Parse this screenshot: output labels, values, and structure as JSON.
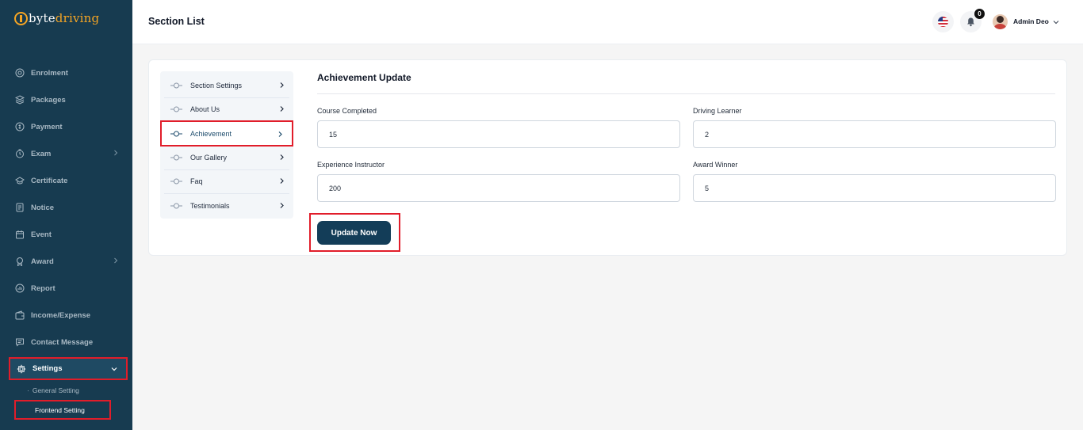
{
  "brand": {
    "part1": "byte",
    "part2": "driving"
  },
  "sidebar": {
    "items": [
      {
        "label": "Enrolment",
        "icon": "enrolment-icon",
        "chevron": false,
        "active": false
      },
      {
        "label": "Packages",
        "icon": "packages-icon",
        "chevron": false,
        "active": false
      },
      {
        "label": "Payment",
        "icon": "payment-icon",
        "chevron": false,
        "active": false
      },
      {
        "label": "Exam",
        "icon": "exam-icon",
        "chevron": true,
        "active": false
      },
      {
        "label": "Certificate",
        "icon": "certificate-icon",
        "chevron": false,
        "active": false
      },
      {
        "label": "Notice",
        "icon": "notice-icon",
        "chevron": false,
        "active": false
      },
      {
        "label": "Event",
        "icon": "event-icon",
        "chevron": false,
        "active": false
      },
      {
        "label": "Award",
        "icon": "award-icon",
        "chevron": true,
        "active": false
      },
      {
        "label": "Report",
        "icon": "report-icon",
        "chevron": false,
        "active": false
      },
      {
        "label": "Income/Expense",
        "icon": "wallet-icon",
        "chevron": false,
        "active": false
      },
      {
        "label": "Contact Message",
        "icon": "message-icon",
        "chevron": false,
        "active": false
      },
      {
        "label": "Settings",
        "icon": "gear-icon",
        "chevron": true,
        "active": true
      }
    ],
    "sub_items": [
      {
        "label": "General Setting",
        "active": false
      },
      {
        "label": "Frontend Setting",
        "active": true
      }
    ]
  },
  "header": {
    "title": "Section List",
    "notification_count": "0",
    "user_name": "Admin Deo"
  },
  "sections": {
    "items": [
      {
        "label": "Section Settings",
        "active": false
      },
      {
        "label": "About Us",
        "active": false
      },
      {
        "label": "Achievement",
        "active": true
      },
      {
        "label": "Our Gallery",
        "active": false
      },
      {
        "label": "Faq",
        "active": false
      },
      {
        "label": "Testimonials",
        "active": false
      }
    ]
  },
  "form": {
    "title": "Achievement Update",
    "fields": {
      "course_completed": {
        "label": "Course Completed",
        "value": "15"
      },
      "driving_learner": {
        "label": "Driving Learner",
        "value": "2"
      },
      "experience_instructor": {
        "label": "Experience Instructor",
        "value": "200"
      },
      "award_winner": {
        "label": "Award Winner",
        "value": "5"
      }
    },
    "submit_label": "Update Now"
  },
  "colors": {
    "sidebar_bg": "#173b50",
    "brand_accent": "#f5a524",
    "primary_button": "#133d58",
    "highlight_border": "#e11d2a"
  }
}
